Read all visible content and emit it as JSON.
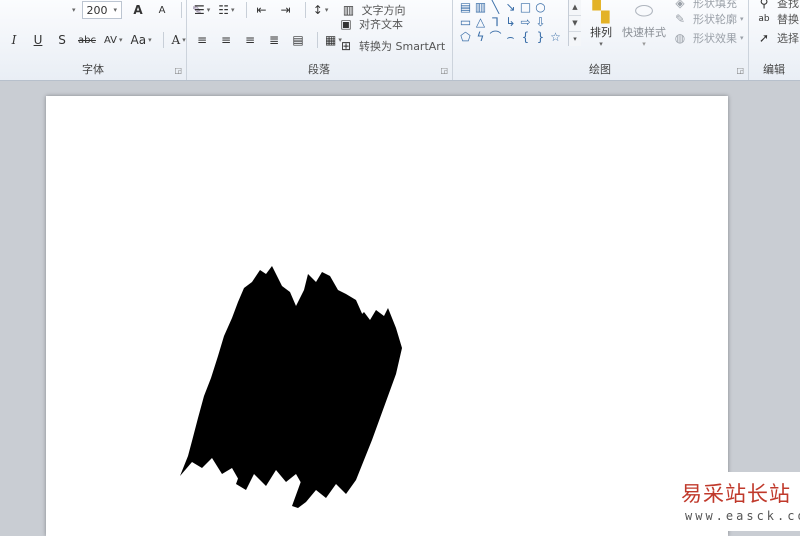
{
  "ribbon": {
    "font_group": {
      "label": "字体",
      "font_size": "200",
      "buttons": {
        "grow": "A",
        "shrink": "A",
        "clear": "✎",
        "italic": "I",
        "underline": "U",
        "shadow": "S",
        "strike": "abc",
        "spacing": "AV",
        "case": "Aa",
        "color": "A"
      }
    },
    "paragraph_group": {
      "label": "段落",
      "text_direction": "文字方向",
      "align_text": "对齐文本",
      "convert_smartart": "转换为 SmartArt"
    },
    "drawing_group": {
      "label": "绘图",
      "arrange": "排列",
      "quick_styles": "快速样式",
      "shape_fill": "形状填充",
      "shape_outline": "形状轮廓",
      "shape_effects": "形状效果"
    },
    "editing_group": {
      "label": "编辑",
      "find": "查找",
      "replace": "替换",
      "select": "选择"
    }
  },
  "watermark": {
    "title": "易采站长站",
    "url": "www.easck.com"
  },
  "colors": {
    "ribbon_bg": "#eef2f8",
    "doc_bg": "#c9cdd3",
    "page_bg": "#ffffff",
    "brush_fill": "#000000",
    "watermark_red": "#c0392b"
  }
}
